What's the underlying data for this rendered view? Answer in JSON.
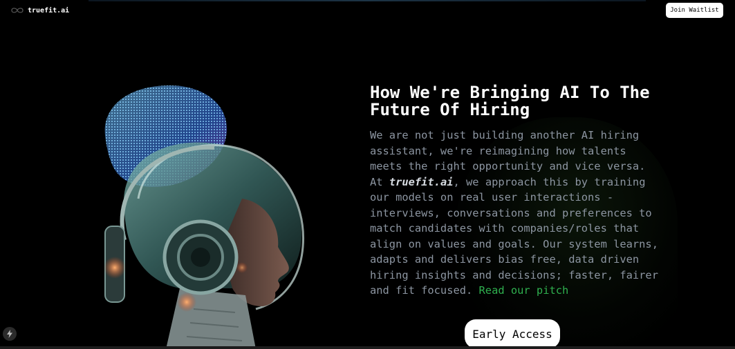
{
  "header": {
    "logo_icon": "infinity-loop-icon",
    "logo_text": "truefit.ai",
    "join_waitlist_label": "Join Waitlist"
  },
  "hero": {
    "heading_line1": "How We're Bringing AI To The",
    "heading_line2": "Future Of Hiring",
    "body_part1": "We are not just building another AI hiring assistant, we're reimagining how talents meets the right opportunity and vice versa. At ",
    "brand_name": "truefit.ai",
    "body_part2": ", we approach this by training our models on real user interactions - interviews, conversations and preferences to match candidates with companies/roles that align on values and goals. Our system learns, adapts and delivers bias free, data driven hiring insights and decisions; faster, fairer and fit focused. ",
    "pitch_link": "Read our pitch",
    "early_access_label": "Early Access",
    "image_subject": "ai-robot-woman-with-headphones-illustration"
  },
  "floating": {
    "bolt_icon": "lightning-bolt-icon"
  },
  "colors": {
    "background": "#000000",
    "body_text": "#8d96a2",
    "link_green": "#2fb14f",
    "button_bg": "#ffffff"
  }
}
